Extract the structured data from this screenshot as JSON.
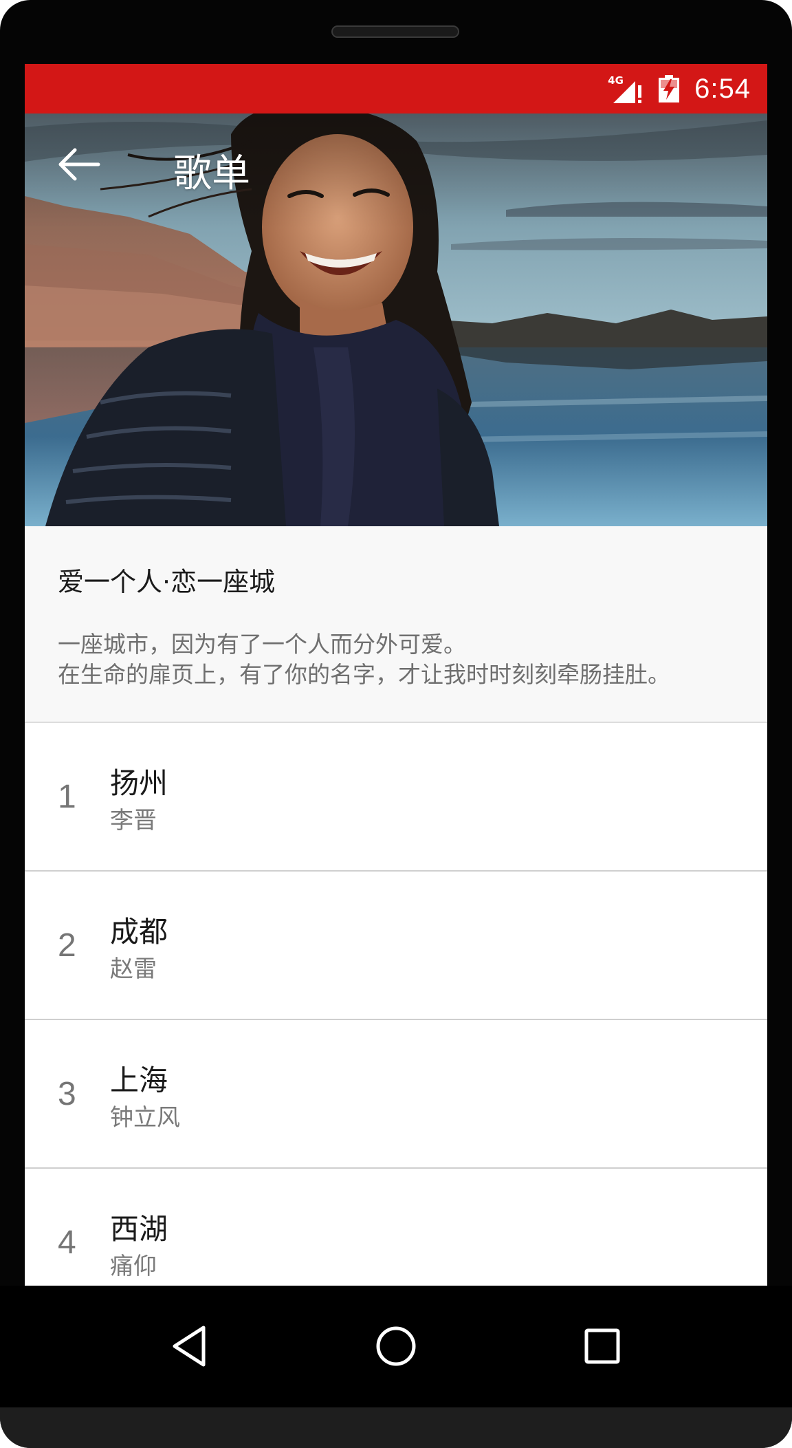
{
  "status_bar": {
    "network_label": "4G",
    "time": "6:54",
    "color": "#d31716"
  },
  "toolbar": {
    "back_icon": "arrow-back-icon",
    "title": "歌单"
  },
  "playlist": {
    "title": "爱一个人·恋一座城",
    "description_lines": [
      "一座城市，因为有了一个人而分外可爱。",
      "在生命的扉页上，有了你的名字，才让我时时刻刻牵肠挂肚。"
    ]
  },
  "songs": [
    {
      "index": "1",
      "title": "扬州",
      "artist": "李晋"
    },
    {
      "index": "2",
      "title": "成都",
      "artist": "赵雷"
    },
    {
      "index": "3",
      "title": "上海",
      "artist": "钟立风"
    },
    {
      "index": "4",
      "title": "西湖",
      "artist": "痛仰"
    }
  ],
  "nav_bar": {
    "icons": [
      "back-triangle-icon",
      "home-circle-icon",
      "recents-square-icon"
    ]
  }
}
